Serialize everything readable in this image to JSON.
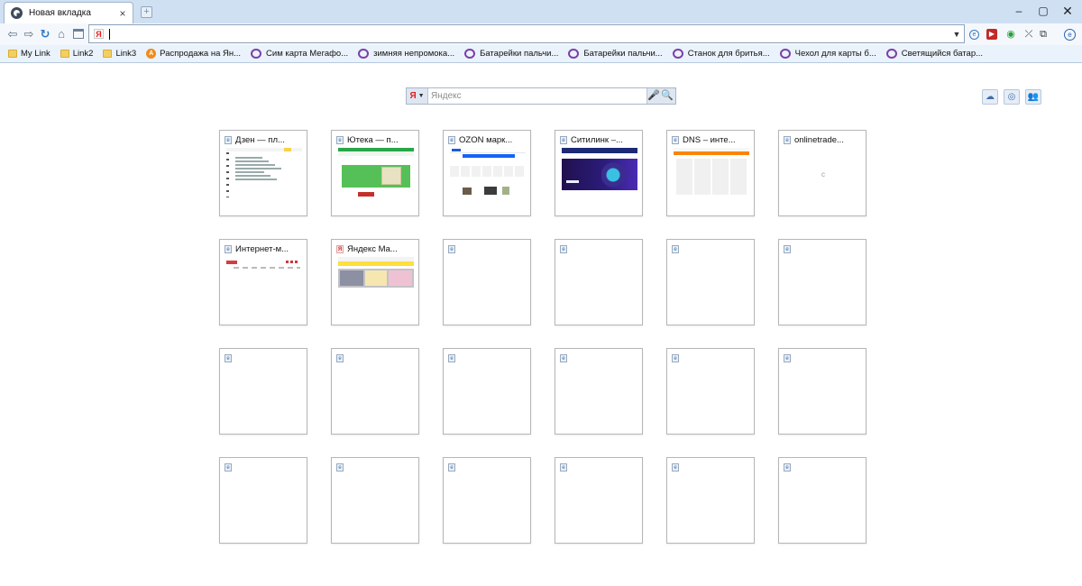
{
  "window": {
    "tab_title": "Новая вкладка",
    "tab_close": "×",
    "new_tab": "+",
    "minimize": "–",
    "maximize": "▢",
    "close": "✕"
  },
  "nav": {
    "back": "⇦",
    "forward": "⇨",
    "reload": "↻",
    "home": "⌂",
    "address_value": "",
    "address_icon": "Я",
    "dropdown": "▼"
  },
  "extensions": [
    "e",
    "▶",
    "◉",
    "⤫",
    "⧉",
    "e"
  ],
  "bookmarks": [
    {
      "label": "My Link",
      "icon": "folder-icon"
    },
    {
      "label": "Link2",
      "icon": "folder-icon"
    },
    {
      "label": "Link3",
      "icon": "folder-icon"
    },
    {
      "label": "Распродажа на Ян...",
      "icon": "aliexpress-icon"
    },
    {
      "label": "Сим карта Мегафо...",
      "icon": "marketplace-icon"
    },
    {
      "label": "зимняя непромока...",
      "icon": "marketplace-icon"
    },
    {
      "label": "Батарейки пальчи...",
      "icon": "marketplace-icon"
    },
    {
      "label": "Батарейки пальчи...",
      "icon": "marketplace-icon"
    },
    {
      "label": "Станок для бритья...",
      "icon": "marketplace-icon"
    },
    {
      "label": "Чехол для карты б...",
      "icon": "marketplace-icon"
    },
    {
      "label": "Светящийся батар...",
      "icon": "marketplace-icon"
    }
  ],
  "search": {
    "brand": "Я",
    "placeholder": "Яндекс",
    "mic": "🎤",
    "go": "🔍"
  },
  "side_icons": [
    "cloud-sync-icon",
    "speed-dial-settings-icon",
    "accounts-icon"
  ],
  "speed_dial": [
    {
      "title": "Дзен — пл...",
      "thumb": "zen",
      "fav": "e"
    },
    {
      "title": "Ютека — п...",
      "thumb": "ut",
      "fav": "e"
    },
    {
      "title": "OZON марк...",
      "thumb": "oz",
      "fav": "e"
    },
    {
      "title": "Ситилинк –...",
      "thumb": "ct",
      "fav": "e"
    },
    {
      "title": "DNS – инте...",
      "thumb": "dns",
      "fav": "e"
    },
    {
      "title": "onlinetrade...",
      "thumb": "ot",
      "fav": "e",
      "thumb_text": "c"
    },
    {
      "title": "Интернет-м...",
      "thumb": "im",
      "fav": "e"
    },
    {
      "title": "Яндекс Ма...",
      "thumb": "ym",
      "fav": "Я"
    },
    {
      "title": "",
      "thumb": "",
      "fav": "e"
    },
    {
      "title": "",
      "thumb": "",
      "fav": "e"
    },
    {
      "title": "",
      "thumb": "",
      "fav": "e"
    },
    {
      "title": "",
      "thumb": "",
      "fav": "e"
    },
    {
      "title": "",
      "thumb": "",
      "fav": "e"
    },
    {
      "title": "",
      "thumb": "",
      "fav": "e"
    },
    {
      "title": "",
      "thumb": "",
      "fav": "e"
    },
    {
      "title": "",
      "thumb": "",
      "fav": "e"
    },
    {
      "title": "",
      "thumb": "",
      "fav": "e"
    },
    {
      "title": "",
      "thumb": "",
      "fav": "e"
    },
    {
      "title": "",
      "thumb": "",
      "fav": "e"
    },
    {
      "title": "",
      "thumb": "",
      "fav": "e"
    },
    {
      "title": "",
      "thumb": "",
      "fav": "e"
    },
    {
      "title": "",
      "thumb": "",
      "fav": "e"
    },
    {
      "title": "",
      "thumb": "",
      "fav": "e"
    },
    {
      "title": "",
      "thumb": "",
      "fav": "e"
    }
  ]
}
